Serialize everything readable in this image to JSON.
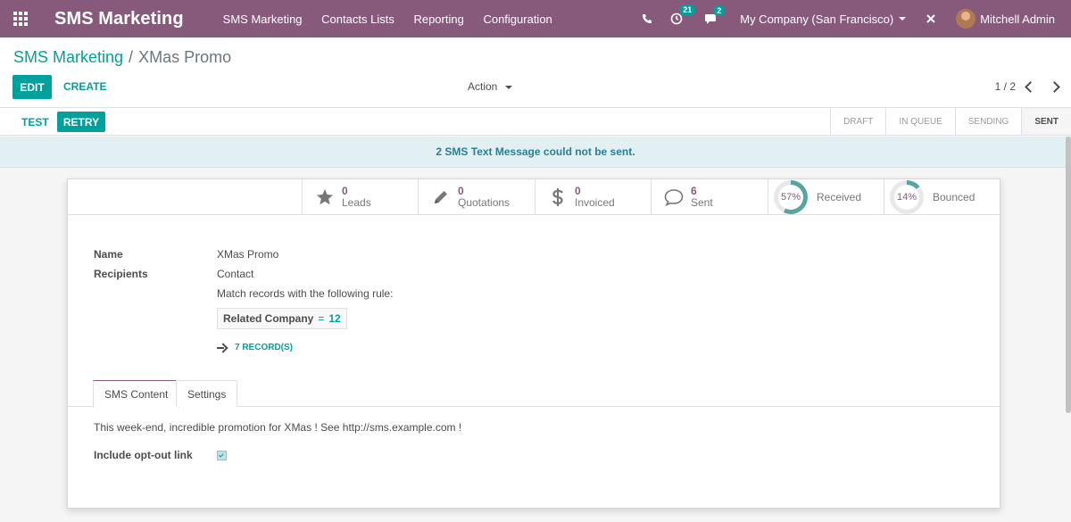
{
  "topbar": {
    "brand": "SMS Marketing",
    "menu": [
      "SMS Marketing",
      "Contacts Lists",
      "Reporting",
      "Configuration"
    ],
    "activity_count": "21",
    "message_count": "2",
    "company": "My Company (San Francisco)",
    "user": "Mitchell Admin"
  },
  "breadcrumb": {
    "parent": "SMS Marketing",
    "separator": "/",
    "current": "XMas Promo"
  },
  "toolbar": {
    "edit": "EDIT",
    "create": "CREATE",
    "action": "Action",
    "pager": "1 / 2"
  },
  "statusbar": {
    "test": "TEST",
    "retry": "RETRY",
    "stages": [
      "DRAFT",
      "IN QUEUE",
      "SENDING",
      "SENT"
    ],
    "current_stage": "SENT"
  },
  "alert": {
    "message": "2  SMS Text Message could not be sent."
  },
  "stats": [
    {
      "value": "0",
      "label": "Leads",
      "icon": "star-icon"
    },
    {
      "value": "0",
      "label": "Quotations",
      "icon": "pencil-icon"
    },
    {
      "value": "0",
      "label": "Invoiced",
      "icon": "dollar-icon"
    },
    {
      "value": "6",
      "label": "Sent",
      "icon": "comment-icon"
    }
  ],
  "rings": [
    {
      "value": "57%",
      "label": "Received",
      "fraction": 0.57
    },
    {
      "value": "14%",
      "label": "Bounced",
      "fraction": 0.14
    }
  ],
  "form": {
    "name_label": "Name",
    "name_value": "XMas Promo",
    "recipients_label": "Recipients",
    "recipients_value": "Contact",
    "rule_text": "Match records with the following rule:",
    "domain_field": "Related Company",
    "domain_operator": "=",
    "domain_value": "12",
    "records_link": "7 RECORD(S)"
  },
  "tabs": [
    "SMS Content",
    "Settings"
  ],
  "content": {
    "body": "This week-end, incredible promotion for XMas ! See http://sms.example.com !",
    "optout_label": "Include opt-out link",
    "optout_checked": true
  },
  "colors": {
    "brand": "#875a7b",
    "accent": "#00a09d",
    "ring_fill": "#56a5a3"
  }
}
